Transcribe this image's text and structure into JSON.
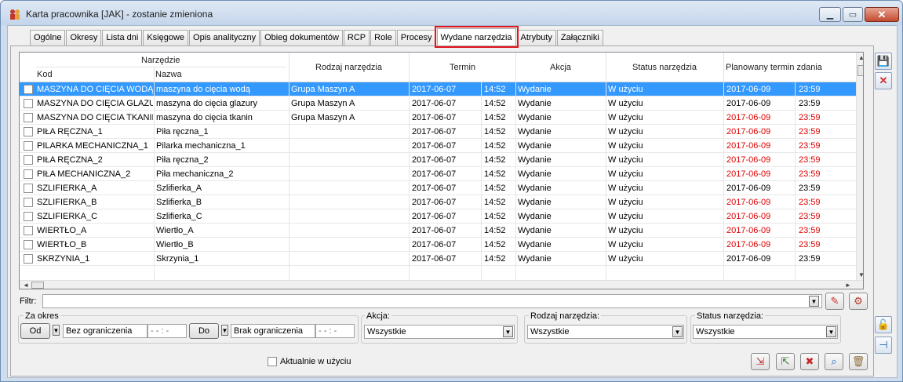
{
  "window": {
    "title": "Karta pracownika [JAK] - zostanie zmieniona",
    "icon": "employee-card-icon"
  },
  "tabs": [
    {
      "label": "Ogólne"
    },
    {
      "label": "Okresy"
    },
    {
      "label": "Lista dni"
    },
    {
      "label": "Księgowe"
    },
    {
      "label": "Opis analityczny"
    },
    {
      "label": "Obieg dokumentów"
    },
    {
      "label": "RCP"
    },
    {
      "label": "Role"
    },
    {
      "label": "Procesy"
    },
    {
      "label": "Wydane narzędzia",
      "active": true
    },
    {
      "label": "Atrybuty"
    },
    {
      "label": "Załączniki"
    }
  ],
  "grid": {
    "group_header": "Narzędzie",
    "headers": {
      "kod": "Kod",
      "nazwa": "Nazwa",
      "rodzaj": "Rodzaj narzędzia",
      "termin": "Termin",
      "akcja": "Akcja",
      "status": "Status narzędzia",
      "planowany": "Planowany termin zdania"
    },
    "rows": [
      {
        "kod": "MASZYNA DO CIĘCIA WODĄ",
        "nazwa": "maszyna do cięcia wodą",
        "rodzaj": "Grupa Maszyn A",
        "data": "2017-06-07",
        "godz": "14:52",
        "akcja": "Wydanie",
        "status": "W użyciu",
        "plan_data": "2017-06-09",
        "plan_godz": "23:59",
        "overdue": false,
        "selected": true
      },
      {
        "kod": "MASZYNA DO CIĘCIA GLAZURY",
        "nazwa": "maszyna do cięcia glazury",
        "rodzaj": "Grupa Maszyn A",
        "data": "2017-06-07",
        "godz": "14:52",
        "akcja": "Wydanie",
        "status": "W użyciu",
        "plan_data": "2017-06-09",
        "plan_godz": "23:59",
        "overdue": false
      },
      {
        "kod": "MASZYNA DO CIĘCIA TKANIN",
        "nazwa": "maszyna do cięcia tkanin",
        "rodzaj": "Grupa Maszyn A",
        "data": "2017-06-07",
        "godz": "14:52",
        "akcja": "Wydanie",
        "status": "W użyciu",
        "plan_data": "2017-06-09",
        "plan_godz": "23:59",
        "overdue": true
      },
      {
        "kod": "PIŁA RĘCZNA_1",
        "nazwa": "Piła ręczna_1",
        "rodzaj": "",
        "data": "2017-06-07",
        "godz": "14:52",
        "akcja": "Wydanie",
        "status": "W użyciu",
        "plan_data": "2017-06-09",
        "plan_godz": "23:59",
        "overdue": true
      },
      {
        "kod": "PILARKA MECHANICZNA_1",
        "nazwa": "Pilarka mechaniczna_1",
        "rodzaj": "",
        "data": "2017-06-07",
        "godz": "14:52",
        "akcja": "Wydanie",
        "status": "W użyciu",
        "plan_data": "2017-06-09",
        "plan_godz": "23:59",
        "overdue": true
      },
      {
        "kod": "PIŁA RĘCZNA_2",
        "nazwa": "Piła ręczna_2",
        "rodzaj": "",
        "data": "2017-06-07",
        "godz": "14:52",
        "akcja": "Wydanie",
        "status": "W użyciu",
        "plan_data": "2017-06-09",
        "plan_godz": "23:59",
        "overdue": true
      },
      {
        "kod": "PIŁA MECHANICZNA_2",
        "nazwa": "Piła mechaniczna_2",
        "rodzaj": "",
        "data": "2017-06-07",
        "godz": "14:52",
        "akcja": "Wydanie",
        "status": "W użyciu",
        "plan_data": "2017-06-09",
        "plan_godz": "23:59",
        "overdue": true
      },
      {
        "kod": "SZLIFIERKA_A",
        "nazwa": "Szlifierka_A",
        "rodzaj": "",
        "data": "2017-06-07",
        "godz": "14:52",
        "akcja": "Wydanie",
        "status": "W użyciu",
        "plan_data": "2017-06-09",
        "plan_godz": "23:59",
        "overdue": false
      },
      {
        "kod": "SZLIFIERKA_B",
        "nazwa": "Szlifierka_B",
        "rodzaj": "",
        "data": "2017-06-07",
        "godz": "14:52",
        "akcja": "Wydanie",
        "status": "W użyciu",
        "plan_data": "2017-06-09",
        "plan_godz": "23:59",
        "overdue": true
      },
      {
        "kod": "SZLIFIERKA_C",
        "nazwa": "Szlifierka_C",
        "rodzaj": "",
        "data": "2017-06-07",
        "godz": "14:52",
        "akcja": "Wydanie",
        "status": "W użyciu",
        "plan_data": "2017-06-09",
        "plan_godz": "23:59",
        "overdue": true
      },
      {
        "kod": "WIERTŁO_A",
        "nazwa": "Wiertło_A",
        "rodzaj": "",
        "data": "2017-06-07",
        "godz": "14:52",
        "akcja": "Wydanie",
        "status": "W użyciu",
        "plan_data": "2017-06-09",
        "plan_godz": "23:59",
        "overdue": true
      },
      {
        "kod": "WIERTŁO_B",
        "nazwa": "Wiertło_B",
        "rodzaj": "",
        "data": "2017-06-07",
        "godz": "14:52",
        "akcja": "Wydanie",
        "status": "W użyciu",
        "plan_data": "2017-06-09",
        "plan_godz": "23:59",
        "overdue": true
      },
      {
        "kod": "SKRZYNIA_1",
        "nazwa": "Skrzynia_1",
        "rodzaj": "",
        "data": "2017-06-07",
        "godz": "14:52",
        "akcja": "Wydanie",
        "status": "W użyciu",
        "plan_data": "2017-06-09",
        "plan_godz": "23:59",
        "overdue": false
      }
    ]
  },
  "filter": {
    "label": "Filtr:",
    "value": ""
  },
  "period": {
    "legend": "Za okres",
    "from_button": "Od",
    "from_value": "Bez ograniczenia",
    "from_time": "- - : -",
    "to_button": "Do",
    "to_value": "Brak ograniczenia",
    "to_time": "- - : -"
  },
  "action_filter": {
    "label": "Akcja:",
    "value": "Wszystkie"
  },
  "type_filter": {
    "label": "Rodzaj narzędzia:",
    "value": "Wszystkie"
  },
  "status_filter": {
    "label": "Status narzędzia:",
    "value": "Wszystkie"
  },
  "current_checkbox": {
    "label": "Aktualnie w użyciu",
    "checked": false
  },
  "colors": {
    "selection": "#3399ff",
    "overdue": "#e00000",
    "active_tab_outline": "#e3141e"
  }
}
